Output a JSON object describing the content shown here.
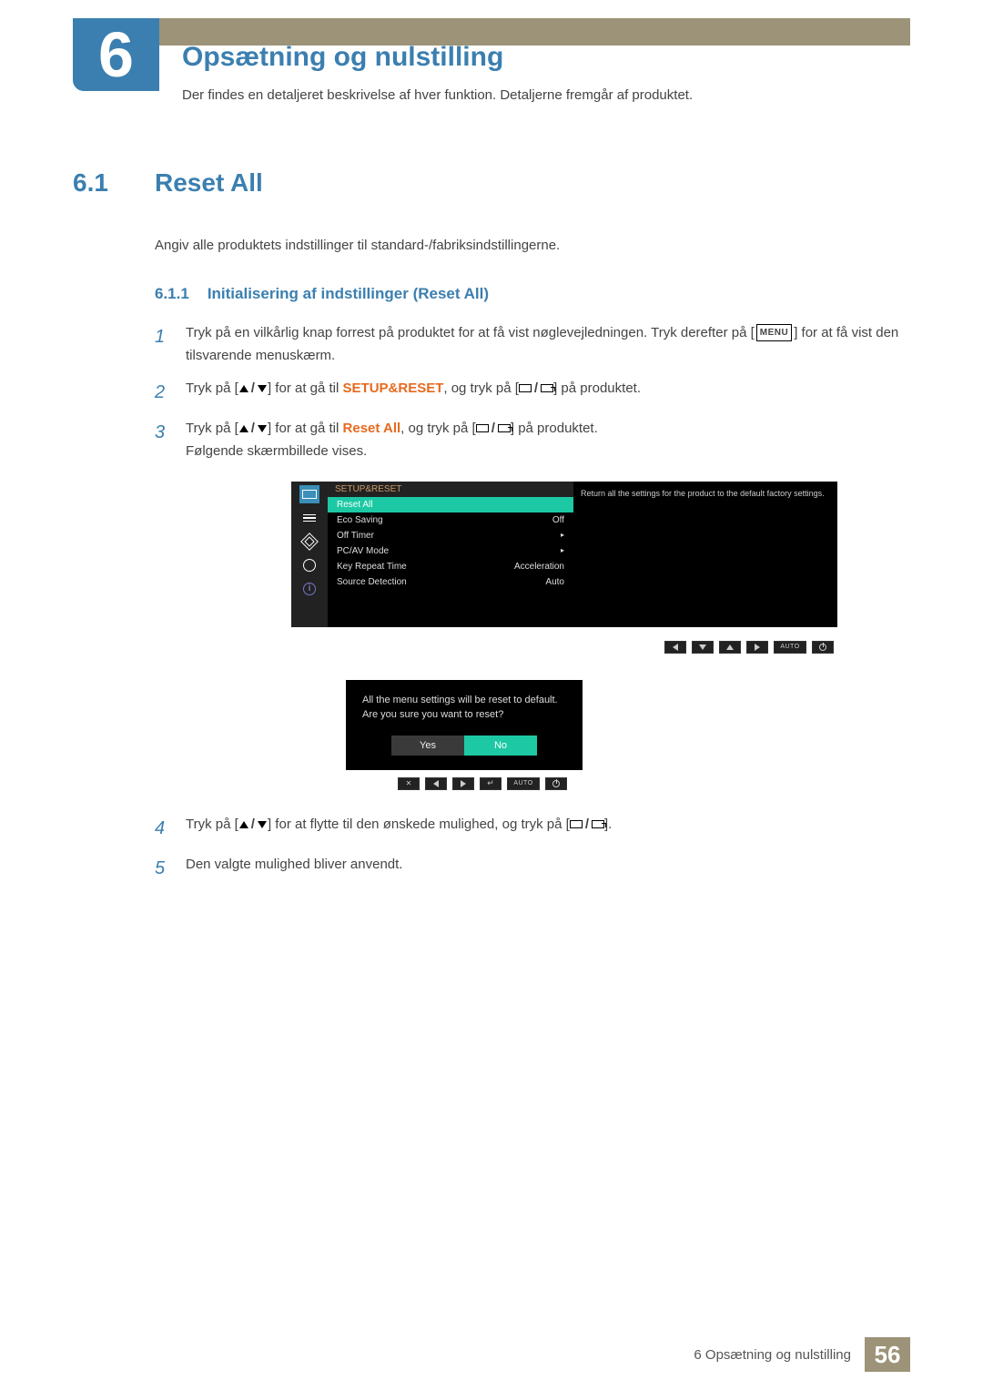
{
  "chapter": {
    "number": "6",
    "title": "Opsætning og nulstilling",
    "subtitle": "Der findes en detaljeret beskrivelse af hver funktion. Detaljerne fremgår af produktet."
  },
  "section": {
    "number": "6.1",
    "title": "Reset All",
    "body": "Angiv alle produktets indstillinger til standard-/fabriksindstillingerne."
  },
  "subsection": {
    "number": "6.1.1",
    "title": "Initialisering af indstillinger (Reset All)"
  },
  "menu_btn_label": "MENU",
  "steps": {
    "s1a": "Tryk på en vilkårlig knap forrest på produktet for at få vist nøglevejledningen. Tryk derefter på [",
    "s1b": "] for at få vist den tilsvarende menuskærm.",
    "s2a": "Tryk på [",
    "s2b": "] for at gå til ",
    "s2bold": "SETUP&RESET",
    "s2c": ", og tryk på [",
    "s2d": "] på produktet.",
    "s3a": "Tryk på [",
    "s3b": "] for at gå til ",
    "s3bold": "Reset All",
    "s3c": ", og tryk på [",
    "s3d": "] på produktet.",
    "s3follow": "Følgende skærmbillede vises.",
    "s4a": "Tryk på [",
    "s4b": "] for at flytte til den ønskede mulighed, og tryk på [",
    "s4c": "].",
    "s5": "Den valgte mulighed bliver anvendt."
  },
  "step_nums": {
    "n1": "1",
    "n2": "2",
    "n3": "3",
    "n4": "4",
    "n5": "5"
  },
  "osd": {
    "header": "SETUP&RESET",
    "help": "Return all the settings for the product to the default factory settings.",
    "rows": [
      {
        "label": "Reset All",
        "value": ""
      },
      {
        "label": "Eco Saving",
        "value": "Off"
      },
      {
        "label": "Off Timer",
        "value": "▸"
      },
      {
        "label": "PC/AV Mode",
        "value": "▸"
      },
      {
        "label": "Key Repeat Time",
        "value": "Acceleration"
      },
      {
        "label": "Source Detection",
        "value": "Auto"
      }
    ],
    "auto_label": "AUTO"
  },
  "dialog": {
    "line1": "All the menu settings will be reset to default.",
    "line2": "Are you sure you want to reset?",
    "yes": "Yes",
    "no": "No",
    "auto_label": "AUTO"
  },
  "footer": {
    "text": "6 Opsætning og nulstilling",
    "page": "56"
  }
}
